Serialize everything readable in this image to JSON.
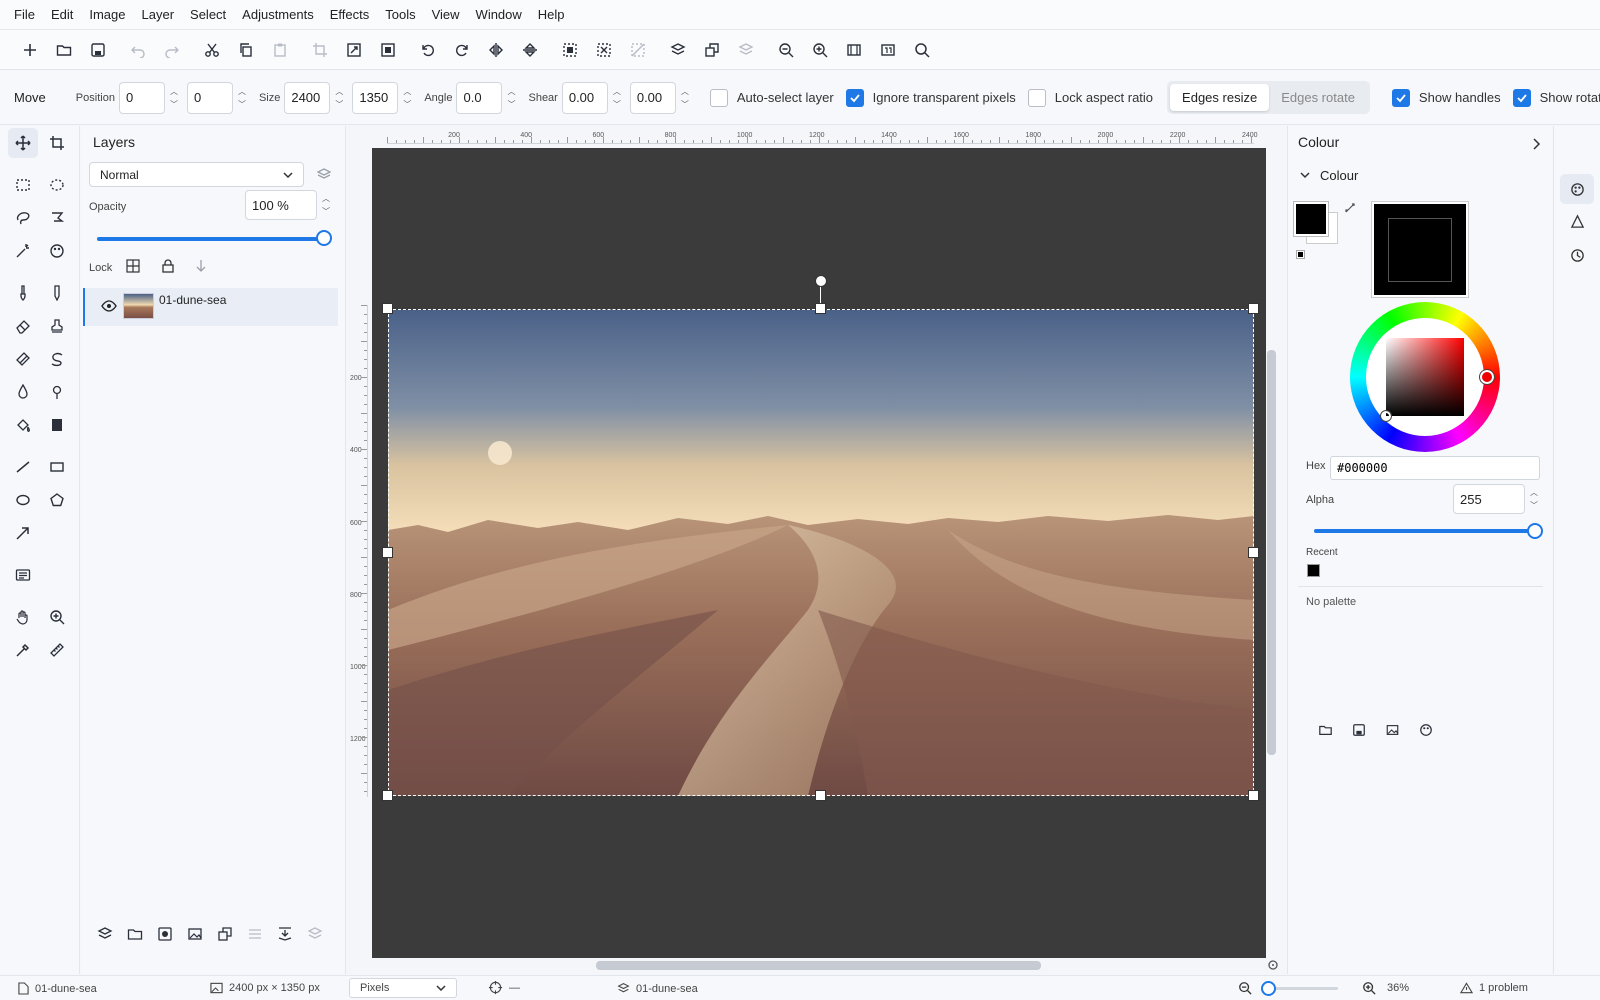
{
  "menu": [
    "File",
    "Edit",
    "Image",
    "Layer",
    "Select",
    "Adjustments",
    "Effects",
    "Tools",
    "View",
    "Window",
    "Help"
  ],
  "options": {
    "tool_name": "Move",
    "position_label": "Position",
    "pos_x": "0",
    "pos_y": "0",
    "size_label": "Size",
    "width": "2400",
    "height": "1350",
    "angle_label": "Angle",
    "angle": "0.0",
    "shear_label": "Shear",
    "shear_x": "0.00",
    "shear_y": "0.00",
    "auto_select_layer": "Auto-select layer",
    "ignore_transparent": "Ignore transparent pixels",
    "lock_aspect": "Lock aspect ratio",
    "edges_resize": "Edges resize",
    "edges_rotate": "Edges rotate",
    "show_handles": "Show handles",
    "show_rotate_node": "Show rotate node",
    "truncated": "S"
  },
  "layers": {
    "title": "Layers",
    "blend_mode": "Normal",
    "opacity_label": "Opacity",
    "opacity_value": "100 %",
    "opacity": 1.0,
    "lock_label": "Lock",
    "items": [
      {
        "name": "01-dune-sea",
        "visible": true
      }
    ]
  },
  "rulers": {
    "h_ticks": [
      "200",
      "400",
      "600",
      "800",
      "1000",
      "1200",
      "1400",
      "1600",
      "1800",
      "2000",
      "2200",
      "2400"
    ],
    "v_ticks": [
      "200",
      "400",
      "600",
      "800",
      "1000",
      "1200"
    ]
  },
  "colour": {
    "panel_title": "Colour",
    "section_title": "Colour",
    "primary": "#000000",
    "secondary": "#ffffff",
    "hex_label": "Hex",
    "hex_value": "#000000",
    "alpha_label": "Alpha",
    "alpha_value": "255",
    "alpha": 1.0,
    "recent_label": "Recent",
    "recent": [
      "#000000"
    ],
    "palette_text": "No palette"
  },
  "status": {
    "doc_name": "01-dune-sea",
    "dimensions": "2400 px × 1350 px",
    "units": "Pixels",
    "cursor_pos": "—",
    "layer_name": "01-dune-sea",
    "zoom": "36%",
    "problems": "1 problem"
  },
  "theme": {
    "accent": "#1e78e6",
    "canvas_bg": "#3b3b3b"
  }
}
